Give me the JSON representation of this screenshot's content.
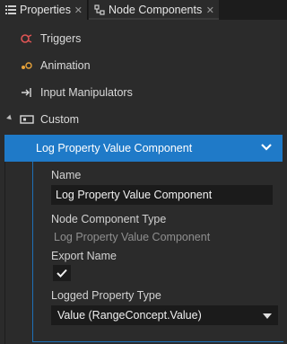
{
  "tabs": [
    {
      "label": "Properties",
      "icon": "properties-icon"
    },
    {
      "label": "Node Components",
      "icon": "node-components-icon"
    }
  ],
  "list": {
    "items": [
      {
        "label": "Triggers",
        "icon": "trigger-icon"
      },
      {
        "label": "Animation",
        "icon": "animation-icon"
      },
      {
        "label": "Input Manipulators",
        "icon": "input-manipulators-icon"
      },
      {
        "label": "Custom",
        "icon": "custom-icon"
      }
    ],
    "selected_label": "Log Property Value Component"
  },
  "inspector": {
    "name_label": "Name",
    "name_value": "Log Property Value Component",
    "type_label": "Node Component Type",
    "type_value": "Log Property Value Component",
    "export_label": "Export Name",
    "export_checked": true,
    "logged_label": "Logged Property Type",
    "logged_value": "Value (RangeConcept.Value)"
  },
  "colors": {
    "accent": "#1f7ac8",
    "trigger_icon": "#e05555",
    "animation_icon": "#e8a33a"
  }
}
